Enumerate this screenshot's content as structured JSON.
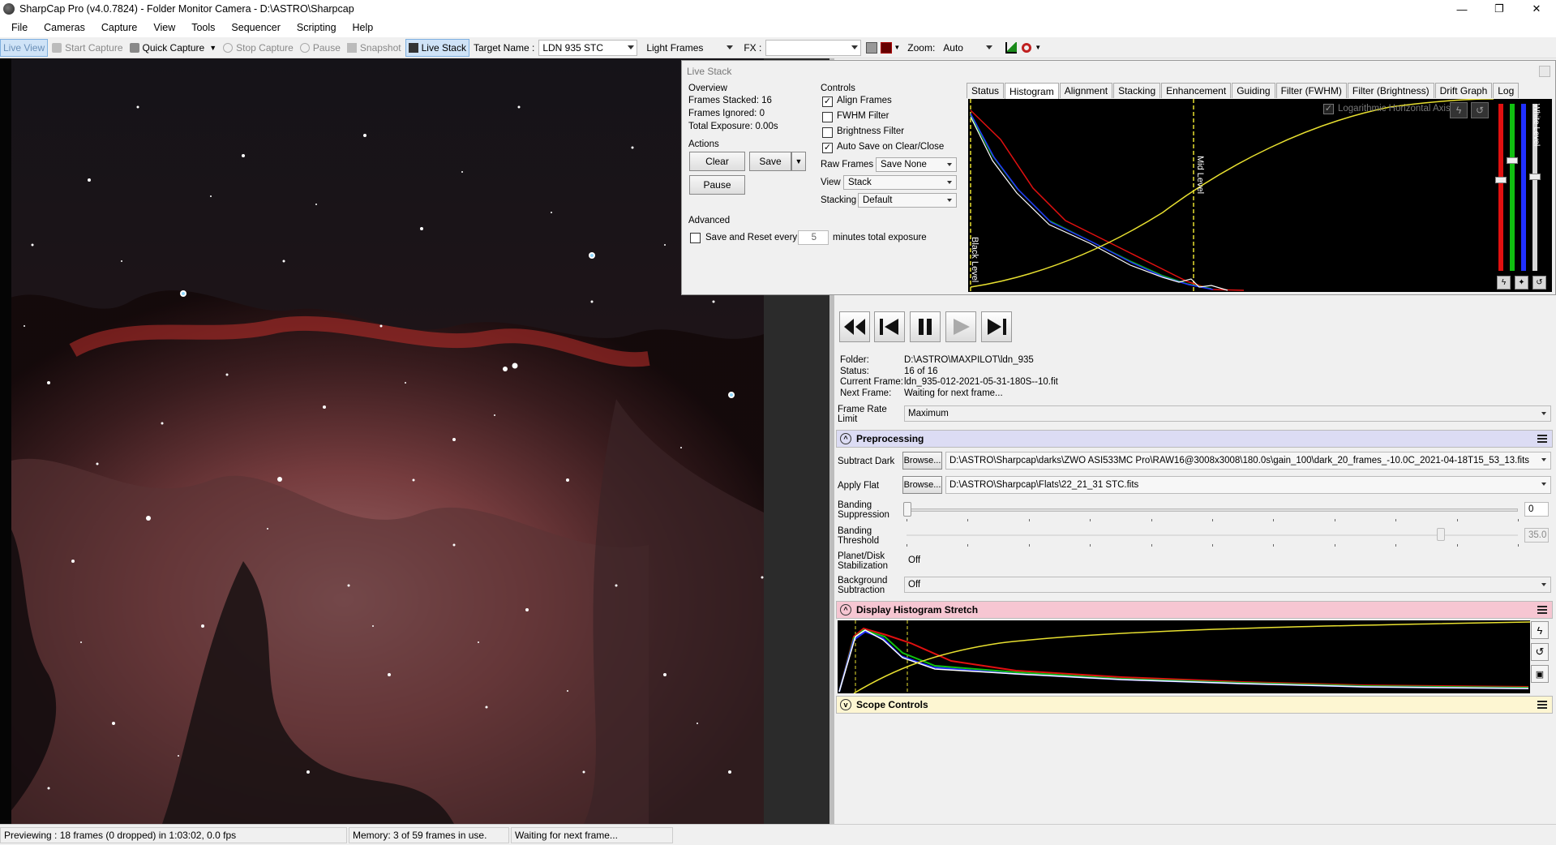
{
  "window": {
    "title": "SharpCap Pro (v4.0.7824) - Folder Monitor Camera - D:\\ASTRO\\Sharpcap",
    "controls": [
      "—",
      "❐",
      "✕"
    ]
  },
  "menu": [
    "File",
    "Cameras",
    "Capture",
    "View",
    "Tools",
    "Sequencer",
    "Scripting",
    "Help"
  ],
  "toolbar": {
    "live_view": "Live View",
    "start_capture": "Start Capture",
    "quick_capture": "Quick Capture",
    "stop_capture": "Stop Capture",
    "pause": "Pause",
    "snapshot": "Snapshot",
    "live_stack": "Live Stack",
    "target_label": "Target Name :",
    "target_value": "LDN 935 STC",
    "frame_type": "Light Frames",
    "fx_label": "FX :",
    "fx_value": "",
    "zoom_label": "Zoom:",
    "zoom_value": "Auto"
  },
  "live_stack": {
    "title": "Live Stack",
    "overview_heading": "Overview",
    "frames_stacked": "Frames Stacked: 16",
    "frames_ignored": "Frames Ignored: 0",
    "total_exposure": "Total Exposure: 0.00s",
    "actions_heading": "Actions",
    "clear": "Clear",
    "save": "Save",
    "pause": "Pause",
    "advanced_heading": "Advanced",
    "save_reset_label": "Save and Reset every",
    "save_reset_value": "5",
    "save_reset_suffix": "minutes total exposure",
    "controls_heading": "Controls",
    "align_frames": "Align Frames",
    "fwhm_filter": "FWHM Filter",
    "brightness_filter": "Brightness Filter",
    "auto_save": "Auto Save on Clear/Close",
    "raw_frames_label": "Raw Frames",
    "raw_frames_value": "Save None",
    "view_label": "View",
    "view_value": "Stack",
    "stacking_label": "Stacking",
    "stacking_value": "Default",
    "tabs": [
      "Status",
      "Histogram",
      "Alignment",
      "Stacking",
      "Enhancement",
      "Guiding",
      "Filter (FWHM)",
      "Filter (Brightness)",
      "Drift Graph",
      "Log"
    ],
    "active_tab": "Histogram",
    "histogram": {
      "log_axis_label": "Logarithmic Horizontal Axis",
      "black_level": "Black Level",
      "mid_level": "Mid Level",
      "white_level": "White Level"
    }
  },
  "folder_monitor": {
    "folder_label": "Folder:",
    "folder_value": "D:\\ASTRO\\MAXPILOT\\ldn_935",
    "status_label": "Status:",
    "status_value": "16 of 16",
    "current_label": "Current Frame:",
    "current_value": "ldn_935-012-2021-05-31-180S--10.fit",
    "next_label": "Next Frame:",
    "next_value": "Waiting for next frame...",
    "frame_rate_label_1": "Frame Rate",
    "frame_rate_label_2": "Limit",
    "frame_rate_value": "Maximum"
  },
  "preprocessing": {
    "title": "Preprocessing",
    "subtract_dark_label": "Subtract Dark",
    "browse": "Browse...",
    "dark_path": "D:\\ASTRO\\Sharpcap\\darks\\ZWO ASI533MC Pro\\RAW16@3008x3008\\180.0s\\gain_100\\dark_20_frames_-10.0C_2021-04-18T15_53_13.fits",
    "apply_flat_label": "Apply Flat",
    "flat_path": "D:\\ASTRO\\Sharpcap\\Flats\\22_21_31 STC.fits",
    "banding_suppression_1": "Banding",
    "banding_suppression_2": "Suppression",
    "banding_suppression_value": "0",
    "banding_threshold_1": "Banding",
    "banding_threshold_2": "Threshold",
    "banding_threshold_value": "35.0",
    "planet_label_1": "Planet/Disk",
    "planet_label_2": "Stabilization",
    "planet_value": "Off",
    "background_label_1": "Background",
    "background_label_2": "Subtraction",
    "background_value": "Off"
  },
  "display_stretch": {
    "title": "Display Histogram Stretch"
  },
  "scope_controls": {
    "title": "Scope Controls"
  },
  "status": {
    "preview": "Previewing : 18 frames (0 dropped) in 1:03:02, 0.0 fps",
    "memory": "Memory: 3 of 59 frames in use.",
    "waiting": "Waiting for next frame..."
  },
  "colors": {
    "accent_active": "#cfe3f7",
    "preprocessing_header": "#dcdcf4",
    "display_stretch_header": "#f6c6d2",
    "scope_controls_header": "#fdf6d2",
    "histogram_red": "#e01010",
    "histogram_green": "#10c010",
    "histogram_blue": "#2030ff",
    "histogram_yellow": "#e8e030"
  }
}
